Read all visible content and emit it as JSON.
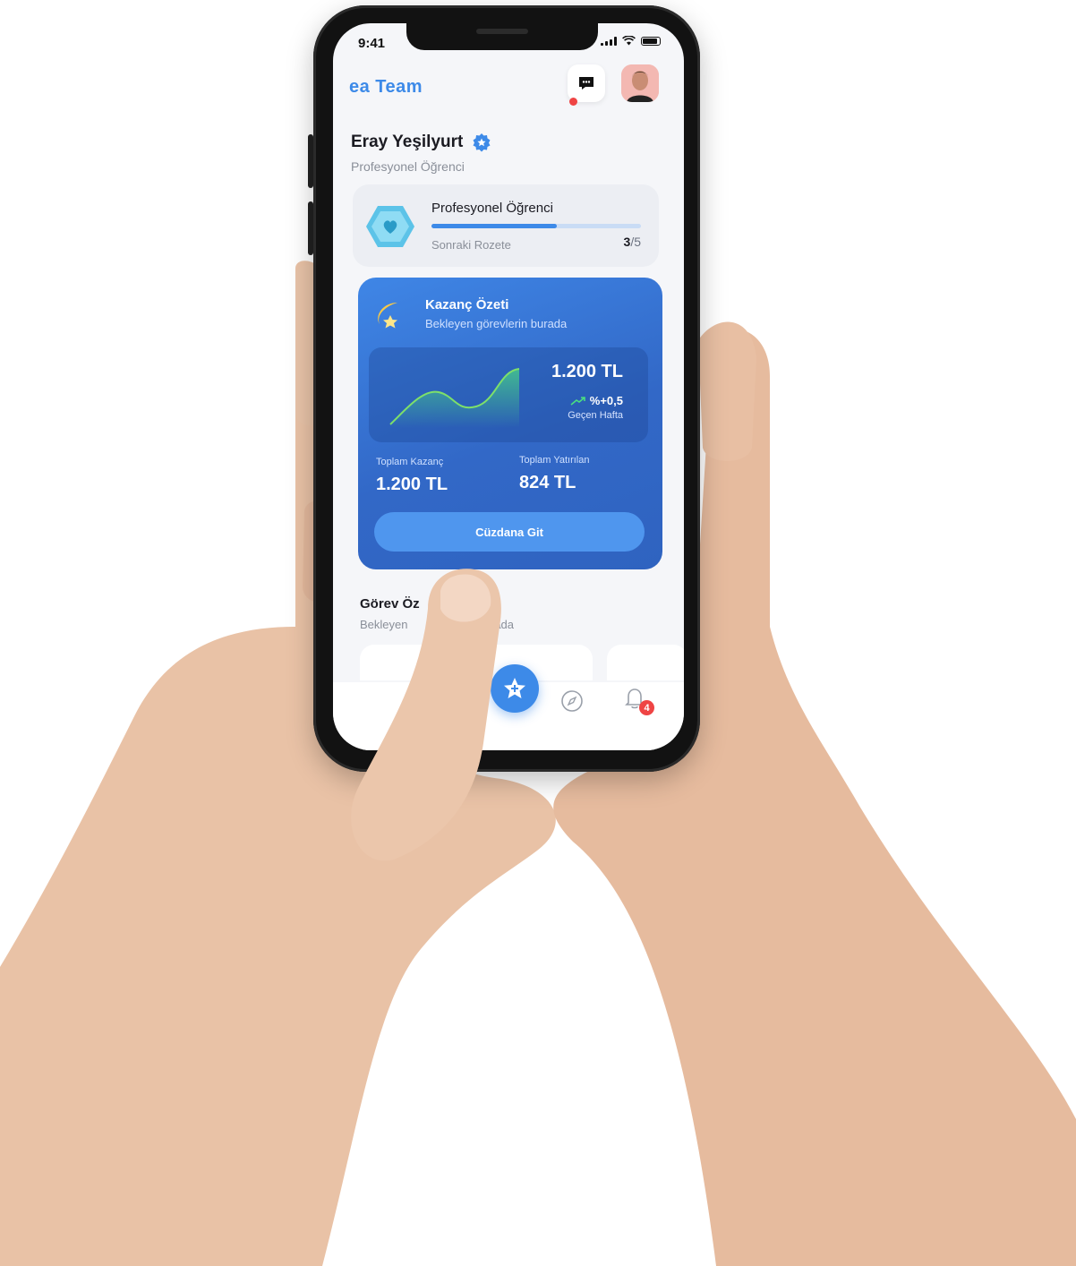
{
  "status_bar": {
    "time": "9:41"
  },
  "header": {
    "logo": "ea Team",
    "chat_icon": "chat-bubble-icon",
    "notification_dot_color": "#ef4444"
  },
  "profile": {
    "name": "Eray Yeşilyurt",
    "role": "Profesyonel Öğrenci",
    "verified_icon": "verified-badge-icon"
  },
  "badge_card": {
    "title": "Profesyonel Öğrenci",
    "next_label": "Sonraki Rozete",
    "current": "3",
    "separator": "/",
    "total": "5",
    "progress": 0.6,
    "icon": "heart-hexagon-icon"
  },
  "earnings_card": {
    "title": "Kazanç Özeti",
    "subtitle": "Bekleyen görevlerin burada",
    "chart_amount": "1.200 TL",
    "change": "%+0,5",
    "change_period": "Geçen Hafta",
    "total_earned_label": "Toplam Kazanç",
    "total_earned_value": "1.200 TL",
    "total_invested_label": "Toplam Yatırılan",
    "total_invested_value": "824 TL",
    "wallet_button": "Cüzdana Git",
    "accent": "#3d8ae8",
    "trend_color": "#4ade80"
  },
  "tasks_section": {
    "title_visible": "Görev Öz",
    "subtitle_left": "Bekleyen",
    "subtitle_right": "rada"
  },
  "bottom_nav": {
    "fab_icon": "star-plus-icon",
    "compass_icon": "compass-icon",
    "bell_icon": "bell-icon",
    "bell_badge": "4"
  }
}
